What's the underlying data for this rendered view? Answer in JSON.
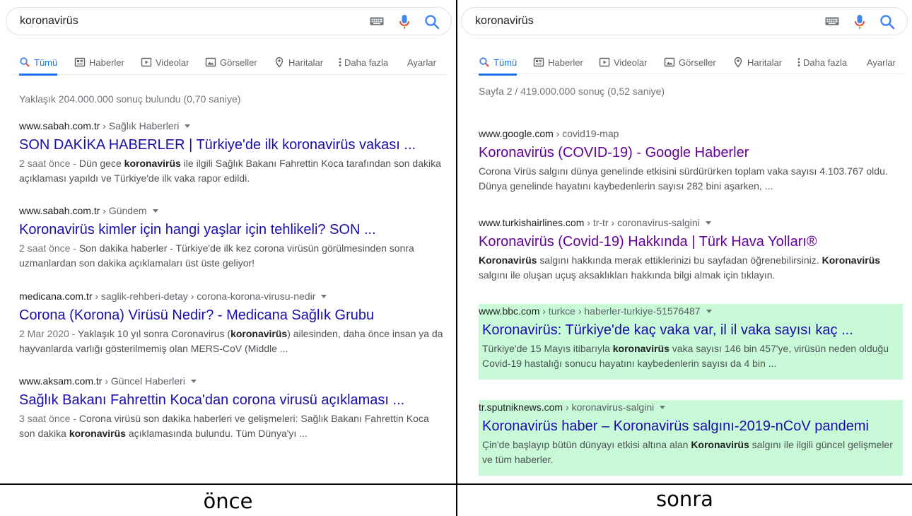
{
  "left": {
    "caption": "önce",
    "search": {
      "query": "koronavirüs"
    },
    "tabs": [
      "Tümü",
      "Haberler",
      "Videolar",
      "Görseller",
      "Haritalar",
      "Daha fazla"
    ],
    "settings": "Ayarlar",
    "stats": "Yaklaşık 204.000.000 sonuç bulundu (0,70 saniye)",
    "results": [
      {
        "domain": "www.sabah.com.tr",
        "crumbs": " › Sağlık Haberleri",
        "title": "SON DAKİKA HABERLER | Türkiye'de ilk koronavirüs vakası ...",
        "date": "2 saat önce - ",
        "s1a": "Dün gece ",
        "s1b": "koronavirüs",
        "s1c": " ile ilgili Sağlık Bakanı Fahrettin Koca tarafından son dakika",
        "s2a": "açıklaması yapıldı ve Türkiye'de ilk vaka rapor edildi.",
        "s2b": "",
        "s2c": ""
      },
      {
        "domain": "www.sabah.com.tr",
        "crumbs": " › Gündem",
        "title": "Koronavirüs kimler için hangi yaşlar için tehlikeli? SON ...",
        "date": "2 saat önce - ",
        "s1a": "Son dakika haberler - Türkiye'de ilk kez corona virüsün görülmesinden sonra",
        "s1b": "",
        "s1c": "",
        "s2a": "uzmanlardan son dakika açıklamaları üst üste geliyor!",
        "s2b": "",
        "s2c": ""
      },
      {
        "domain": "medicana.com.tr",
        "crumbs": " › saglik-rehberi-detay › corona-korona-virusu-nedir",
        "title": "Corona (Korona) Virüsü Nedir? - Medicana Sağlık Grubu",
        "date": "2 Mar 2020 - ",
        "s1a": "Yaklaşık 10 yıl sonra Coronavirus (",
        "s1b": "koronavirüs",
        "s1c": ") ailesinden, daha önce insan ya da",
        "s2a": "hayvanlarda varlığı gösterilmemiş olan MERS-CoV (Middle ...",
        "s2b": "",
        "s2c": ""
      },
      {
        "domain": "www.aksam.com.tr",
        "crumbs": " › Güncel Haberleri",
        "title": "Sağlık Bakanı Fahrettin Koca'dan corona virusü açıklaması ...",
        "date": "3 saat önce - ",
        "s1a": "Corona virüsü son dakika haberleri ve gelişmeleri: Sağlık Bakanı Fahrettin Koca",
        "s1b": "",
        "s1c": "",
        "s2a": "son dakika ",
        "s2b": "koronavirüs",
        "s2c": " açıklamasında bulundu. Tüm Dünya'yı ..."
      }
    ]
  },
  "right": {
    "caption": "sonra",
    "search": {
      "query": "koronavirüs"
    },
    "tabs": [
      "Tümü",
      "Haberler",
      "Videolar",
      "Görseller",
      "Haritalar",
      "Daha fazla"
    ],
    "settings": "Ayarlar",
    "stats": "Sayfa 2 / 419.000.000 sonuç (0,52 saniye)",
    "results": [
      {
        "domain": "www.google.com",
        "crumbs": " › covid19-map",
        "title": "Koronavirüs (COVID-19) - Google Haberler",
        "date": "",
        "s1a": "Corona Virüs salgını dünya genelinde etkisini sürdürürken toplam vaka sayısı 4.103.767 oldu.",
        "s1b": "",
        "s1c": "",
        "s2a": "Dünya genelinde hayatını kaybedenlerin sayısı 282 bini aşarken, ...",
        "s2b": "",
        "s2c": ""
      },
      {
        "domain": "www.turkishairlines.com",
        "crumbs": " › tr-tr › coronavirus-salgini",
        "title": "Koronavirüs (Covid-19) Hakkında | Türk Hava Yolları®",
        "date": "",
        "s1a": "",
        "s1b": "Koronavirüs",
        "s1c": " salgını hakkında merak ettiklerinizi bu sayfadan öğrenebilirsiniz. ",
        "s1d": "Koronavirüs",
        "s2a": "salgını ile oluşan uçuş aksaklıkları hakkında bilgi almak için tıklayın.",
        "s2b": "",
        "s2c": ""
      },
      {
        "domain": "www.bbc.com",
        "crumbs": " › turkce › haberler-turkiye-51576487",
        "title": "Koronavirüs: Türkiye'de kaç vaka var, il il vaka sayısı kaç ...",
        "date": "",
        "s1a": "Türkiye'de 15 Mayıs itibarıyla ",
        "s1b": "koronavirüs",
        "s1c": " vaka sayısı 146 bin 457'ye, virüsün neden olduğu",
        "s2a": "Covid-19 hastalığı sonucu hayatını kaybedenlerin sayısı da 4 bin ...",
        "s2b": "",
        "s2c": ""
      },
      {
        "domain": "tr.sputniknews.com",
        "crumbs": " › koronavirus-salgini",
        "title": "Koronavirüs haber – Koronavirüs salgını-2019-nCoV pandemi",
        "date": "",
        "s1a": "Çin'de başlayıp bütün dünyayı etkisi altına alan ",
        "s1b": "Koronavirüs",
        "s1c": " salgını ile ilgili güncel gelişmeler",
        "s2a": "ve tüm haberler.",
        "s2b": "",
        "s2c": ""
      }
    ]
  },
  "colors": {
    "link": "#1a0dab",
    "visited": "#660099",
    "accent": "#1a73e8",
    "highlight": "#c8fad7"
  }
}
